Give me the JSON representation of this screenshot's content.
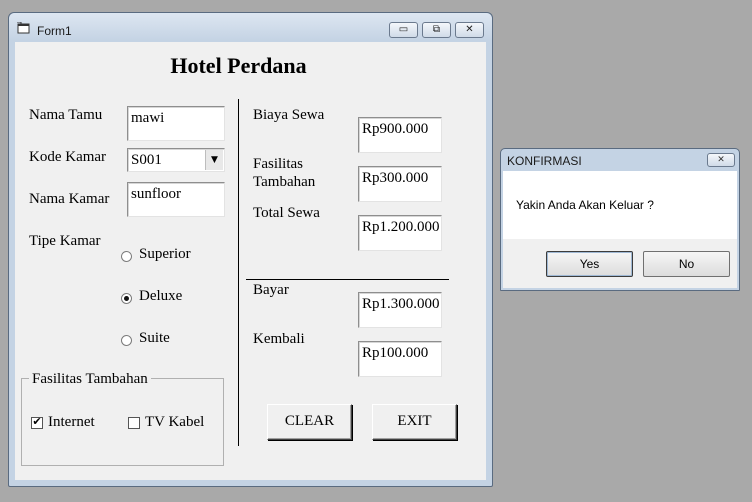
{
  "window": {
    "title": "Form1",
    "heading": "Hotel Perdana",
    "buttons": {
      "minimize": "▭",
      "maximize": "⧉",
      "close": "✕"
    }
  },
  "form": {
    "nama_tamu": {
      "label": "Nama Tamu",
      "value": "mawi"
    },
    "kode_kamar": {
      "label": "Kode Kamar",
      "value": "S001",
      "arrow": "▼"
    },
    "nama_kamar": {
      "label": "Nama Kamar",
      "value": "sunfloor"
    },
    "tipe_kamar": {
      "label": "Tipe Kamar",
      "options": [
        "Superior",
        "Deluxe",
        "Suite"
      ],
      "selected": "Deluxe"
    },
    "fasilitas": {
      "group_label": "Fasilitas Tambahan",
      "internet": {
        "label": "Internet",
        "checked": true,
        "mark": "✔"
      },
      "tv_kabel": {
        "label": "TV Kabel",
        "checked": false
      }
    },
    "biaya_sewa": {
      "label": "Biaya Sewa",
      "value": "Rp900.000"
    },
    "fasilitas_tambahan": {
      "label_line1": "Fasilitas",
      "label_line2": "Tambahan",
      "value": "Rp300.000"
    },
    "total_sewa": {
      "label": "Total Sewa",
      "value": "Rp1.200.000"
    },
    "bayar": {
      "label": "Bayar",
      "value": "Rp1.300.000"
    },
    "kembali": {
      "label": "Kembali",
      "value": "Rp100.000"
    },
    "clear_label": "CLEAR",
    "exit_label": "EXIT"
  },
  "dialog": {
    "title": "KONFIRMASI",
    "close": "✕",
    "message": "Yakin Anda Akan Keluar ?",
    "yes_label": "Yes",
    "no_label": "No"
  }
}
